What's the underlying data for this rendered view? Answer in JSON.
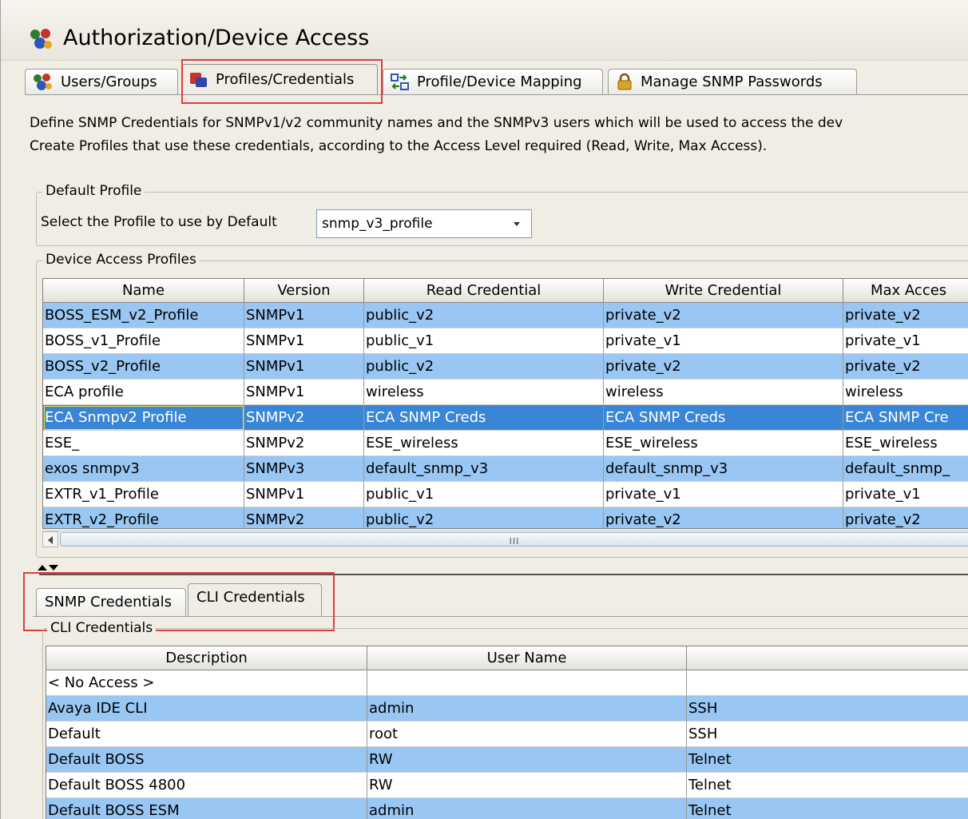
{
  "window": {
    "title": "Authorization/Device Access"
  },
  "tabs": [
    {
      "label": "Users/Groups",
      "icon": "users-groups-icon"
    },
    {
      "label": "Profiles/Credentials",
      "icon": "profiles-credentials-icon"
    },
    {
      "label": "Profile/Device Mapping",
      "icon": "profile-mapping-icon"
    },
    {
      "label": "Manage SNMP Passwords",
      "icon": "lock-icon"
    }
  ],
  "description": {
    "line1": "Define SNMP Credentials for SNMPv1/v2 community names and the SNMPv3 users which will be used to access the dev",
    "line2": "Create Profiles that use these credentials, according to the Access Level required (Read, Write, Max Access)."
  },
  "default_profile": {
    "legend": "Default Profile",
    "select_label": "Select the Profile to use by Default",
    "selected": "snmp_v3_profile"
  },
  "profiles": {
    "legend": "Device Access Profiles",
    "columns": [
      "Name",
      "Version",
      "Read Credential",
      "Write Credential",
      "Max Acces"
    ],
    "rows": [
      [
        "BOSS_ESM_v2_Profile",
        "SNMPv1",
        "public_v2",
        "private_v2",
        "private_v2"
      ],
      [
        "BOSS_v1_Profile",
        "SNMPv1",
        "public_v1",
        "private_v1",
        "private_v1"
      ],
      [
        "BOSS_v2_Profile",
        "SNMPv1",
        "public_v2",
        "private_v2",
        "private_v2"
      ],
      [
        "ECA profile",
        "SNMPv1",
        "wireless",
        "wireless",
        "wireless"
      ],
      [
        "ECA Snmpv2 Profile",
        "SNMPv2",
        "ECA SNMP Creds",
        "ECA SNMP Creds",
        "ECA SNMP Cre"
      ],
      [
        "ESE_",
        "SNMPv2",
        "ESE_wireless",
        "ESE_wireless",
        "ESE_wireless"
      ],
      [
        "exos snmpv3",
        "SNMPv3",
        "default_snmp_v3",
        "default_snmp_v3",
        "default_snmp_"
      ],
      [
        "EXTR_v1_Profile",
        "SNMPv1",
        "public_v1",
        "private_v1",
        "private_v1"
      ],
      [
        "EXTR_v2_Profile",
        "SNMPv2",
        "public_v2",
        "private_v2",
        "private_v2"
      ]
    ],
    "scroll_grip": "III"
  },
  "sub_tabs": [
    "SNMP Credentials",
    "CLI Credentials"
  ],
  "cli": {
    "legend": "CLI Credentials",
    "columns": [
      "Description",
      "User Name",
      ""
    ],
    "rows": [
      [
        "< No Access >",
        "",
        ""
      ],
      [
        "Avaya IDE CLI",
        "admin",
        "SSH"
      ],
      [
        "Default",
        "root",
        "SSH"
      ],
      [
        "Default BOSS",
        "RW",
        "Telnet"
      ],
      [
        "Default BOSS 4800",
        "RW",
        "Telnet"
      ],
      [
        "Default BOSS ESM",
        "admin",
        "Telnet"
      ]
    ]
  },
  "colors": {
    "row_alt": "#99c6f2",
    "row_selected": "#3a86d6",
    "highlight": "#e23b3b"
  }
}
